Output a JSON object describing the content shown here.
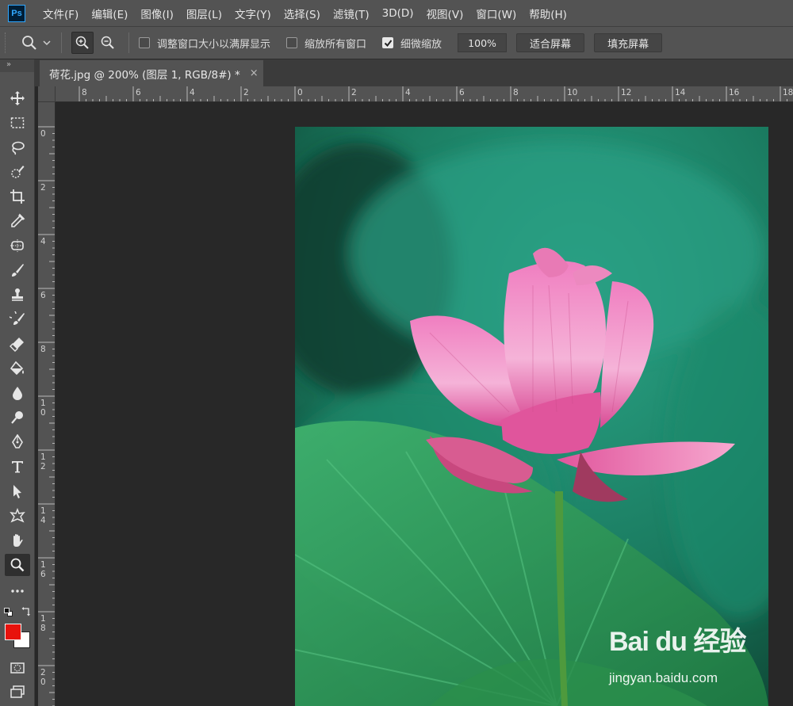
{
  "app": {
    "logo_text": "Ps"
  },
  "menu": [
    "文件(F)",
    "编辑(E)",
    "图像(I)",
    "图层(L)",
    "文字(Y)",
    "选择(S)",
    "滤镜(T)",
    "3D(D)",
    "视图(V)",
    "窗口(W)",
    "帮助(H)"
  ],
  "options": {
    "resize_windows_label": "调整窗口大小以满屏显示",
    "resize_windows_checked": false,
    "zoom_all_label": "缩放所有窗口",
    "zoom_all_checked": false,
    "scrubby_zoom_label": "细微缩放",
    "scrubby_zoom_checked": true,
    "zoom_value": "100%",
    "fit_screen_label": "适合屏幕",
    "fill_screen_label": "填充屏幕"
  },
  "toolbar": {
    "collapse_label": "»"
  },
  "document": {
    "tab_title": "荷花.jpg @ 200% (图层 1, RGB/8#) *",
    "close_label": "×"
  },
  "rulers": {
    "horizontal": [
      "8",
      "6",
      "4",
      "2",
      "0",
      "2",
      "4",
      "6",
      "8",
      "10",
      "12",
      "14",
      "16",
      "18"
    ],
    "vertical": [
      "0",
      "2",
      "4",
      "6",
      "8",
      "10",
      "12",
      "14",
      "16",
      "18",
      "20"
    ]
  },
  "colors": {
    "foreground": "#e8120c",
    "background": "#ffffff",
    "accent": "#31a8ff"
  },
  "watermark": {
    "brand": "Bai du 经验",
    "url": "jingyan.baidu.com"
  }
}
